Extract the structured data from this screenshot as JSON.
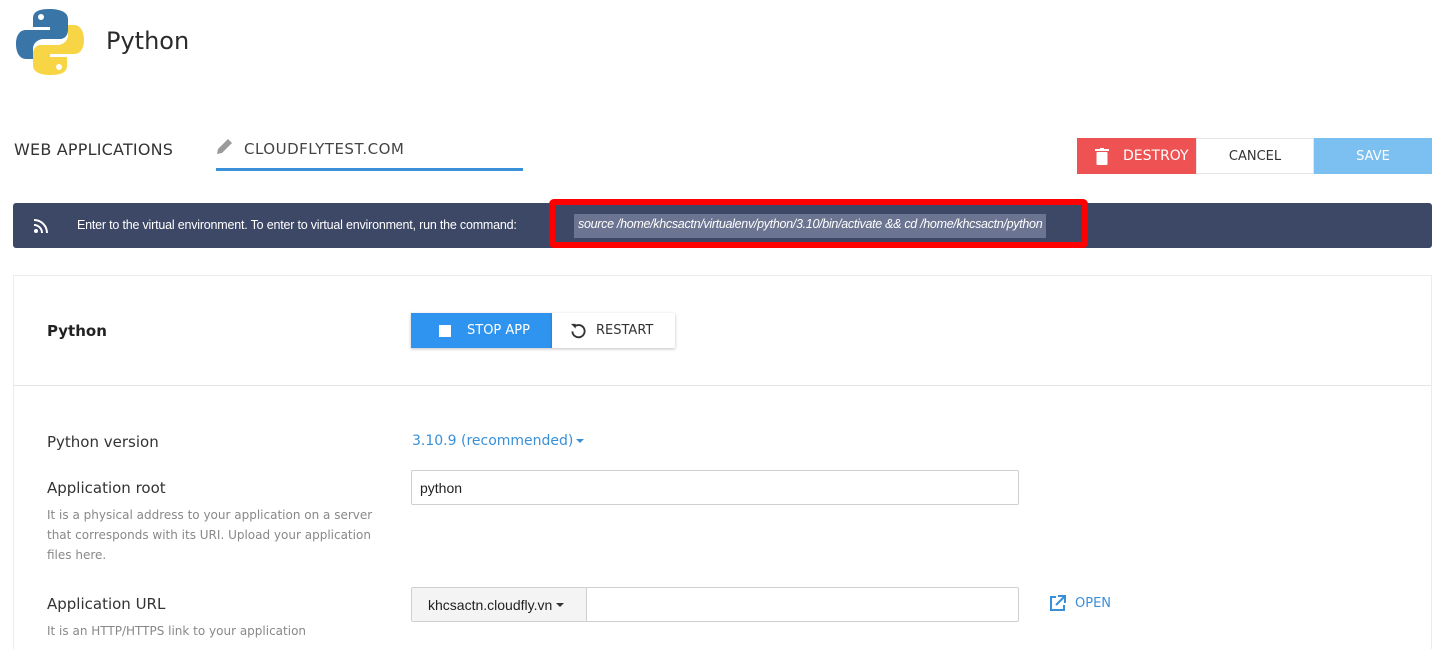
{
  "header": {
    "app_title": "Python"
  },
  "breadcrumb": {
    "root": "WEB APPLICATIONS",
    "domain": "CLOUDFLYTEST.COM"
  },
  "toolbar": {
    "destroy_label": "DESTROY",
    "cancel_label": "CANCEL",
    "save_label": "SAVE"
  },
  "notice": {
    "message": "Enter to the virtual environment. To enter to virtual environment, run the command:",
    "command": "source /home/khcsactn/virtualenv/python/3.10/bin/activate && cd /home/khcsactn/python"
  },
  "panel": {
    "title": "Python",
    "stop_label": "STOP APP",
    "restart_label": "RESTART",
    "version_label": "Python version",
    "version_value": "3.10.9 (recommended)",
    "root_label": "Application root",
    "root_hint": "It is a physical address to your application on a server that corresponds with its URI. Upload your application files here.",
    "root_value": "python",
    "url_label": "Application URL",
    "url_hint": "It is an HTTP/HTTPS link to your application",
    "url_domain": "khcsactn.cloudfly.vn",
    "url_path": "",
    "open_label": "OPEN"
  },
  "colors": {
    "accent": "#2f94ef",
    "danger": "#ee5253",
    "notice_bg": "#3d4766",
    "highlight": "#ff0000"
  }
}
